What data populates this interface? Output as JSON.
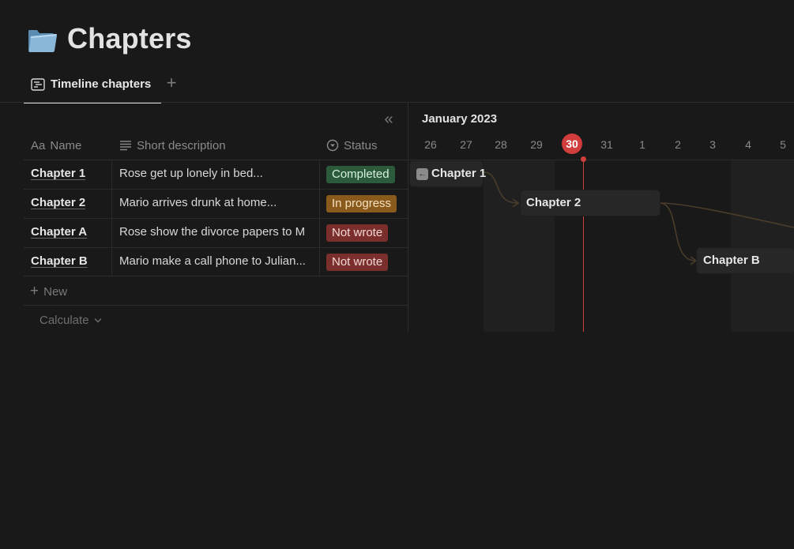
{
  "page": {
    "title": "Chapters",
    "icon": "folder-icon"
  },
  "views": {
    "active_tab": {
      "label": "Timeline chapters",
      "icon": "timeline-icon"
    },
    "add_icon": "plus-icon"
  },
  "table": {
    "columns": [
      {
        "prefix": "Aa",
        "label": "Name"
      },
      {
        "icon": "text-lines-icon",
        "label": "Short description"
      },
      {
        "icon": "status-icon",
        "label": "Status"
      }
    ],
    "rows": [
      {
        "name": "Chapter 1",
        "description": "Rose get up lonely in bed...",
        "status": "Completed"
      },
      {
        "name": "Chapter 2",
        "description": "Mario arrives drunk at home...",
        "status": "In progress"
      },
      {
        "name": "Chapter A",
        "description": "Rose show the divorce papers to M",
        "status": "Not wrote"
      },
      {
        "name": "Chapter B",
        "description": "Mario make a call phone to Julian...",
        "status": "Not wrote"
      }
    ],
    "new_label": "New",
    "calculate_label": "Calculate",
    "collapse_icon": "double-chevron-left-icon"
  },
  "status_colors": {
    "Completed": {
      "bg": "#2b5b3b",
      "fg": "#d8f0df"
    },
    "In progress": {
      "bg": "#8a5a1c",
      "fg": "#f5e1c0"
    },
    "Not wrote": {
      "bg": "#7a2f2c",
      "fg": "#f5d8d5"
    }
  },
  "timeline": {
    "month": "January 2023",
    "days": [
      "26",
      "27",
      "28",
      "29",
      "30",
      "31",
      "1",
      "2",
      "3",
      "4",
      "5"
    ],
    "today": "30",
    "today_color": "#d13d3d",
    "bars": [
      {
        "label": "Chapter 1"
      },
      {
        "label": "Chapter 2"
      },
      {
        "label": "Chapter B"
      }
    ]
  }
}
